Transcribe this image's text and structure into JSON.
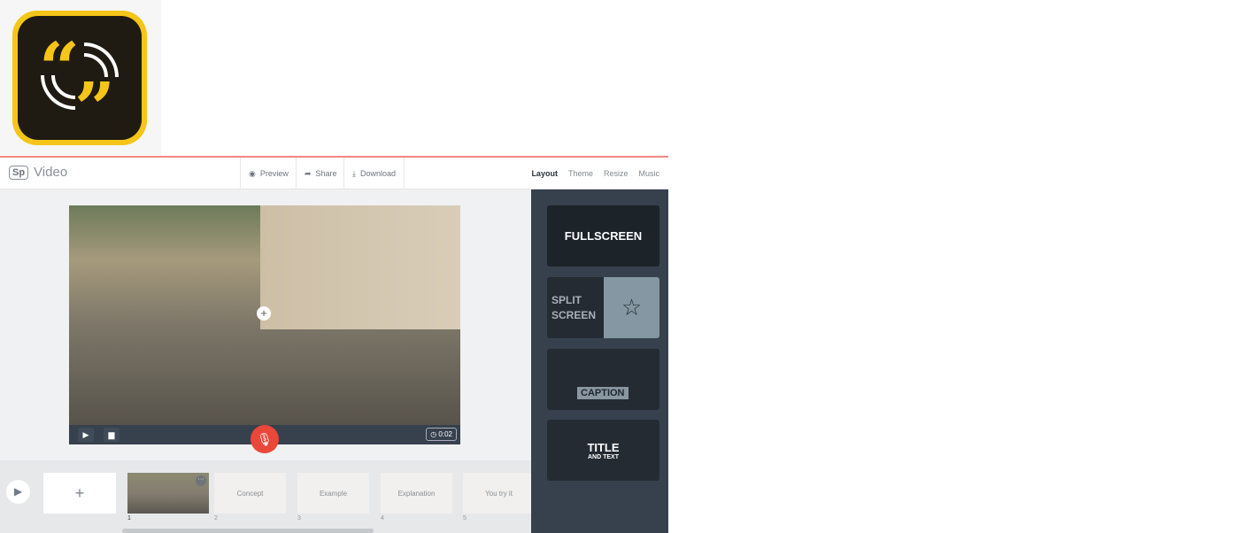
{
  "logo": {
    "name": "Adobe Spark Video logo",
    "colors": {
      "frame": "#f5c518",
      "inner": "#1f1b12"
    }
  },
  "topbar": {
    "brand_mark": "Sp",
    "brand_name": "Video",
    "preview": "Preview",
    "share": "Share",
    "download": "Download",
    "tabs": [
      {
        "label": "Layout",
        "active": true
      },
      {
        "label": "Theme"
      },
      {
        "label": "Resize"
      },
      {
        "label": "Music"
      }
    ]
  },
  "player": {
    "timer": "0:02",
    "play_icon": "play-icon",
    "caption_icon": "speech-bubble-icon",
    "mic_icon": "microphone-icon",
    "accent": "#e9473a"
  },
  "timeline": {
    "add_label": "+",
    "slides": [
      {
        "number": "1",
        "label": ""
      },
      {
        "number": "2",
        "label": "Concept"
      },
      {
        "number": "3",
        "label": "Example"
      },
      {
        "number": "4",
        "label": "Explanation"
      },
      {
        "number": "5",
        "label": "You try it"
      }
    ]
  },
  "layouts": {
    "fullscreen": "FULLSCREEN",
    "split_line1": "SPLIT",
    "split_line2": "SCREEN",
    "caption": "CAPTION",
    "title": "TITLE",
    "title_sub": "AND TEXT"
  }
}
